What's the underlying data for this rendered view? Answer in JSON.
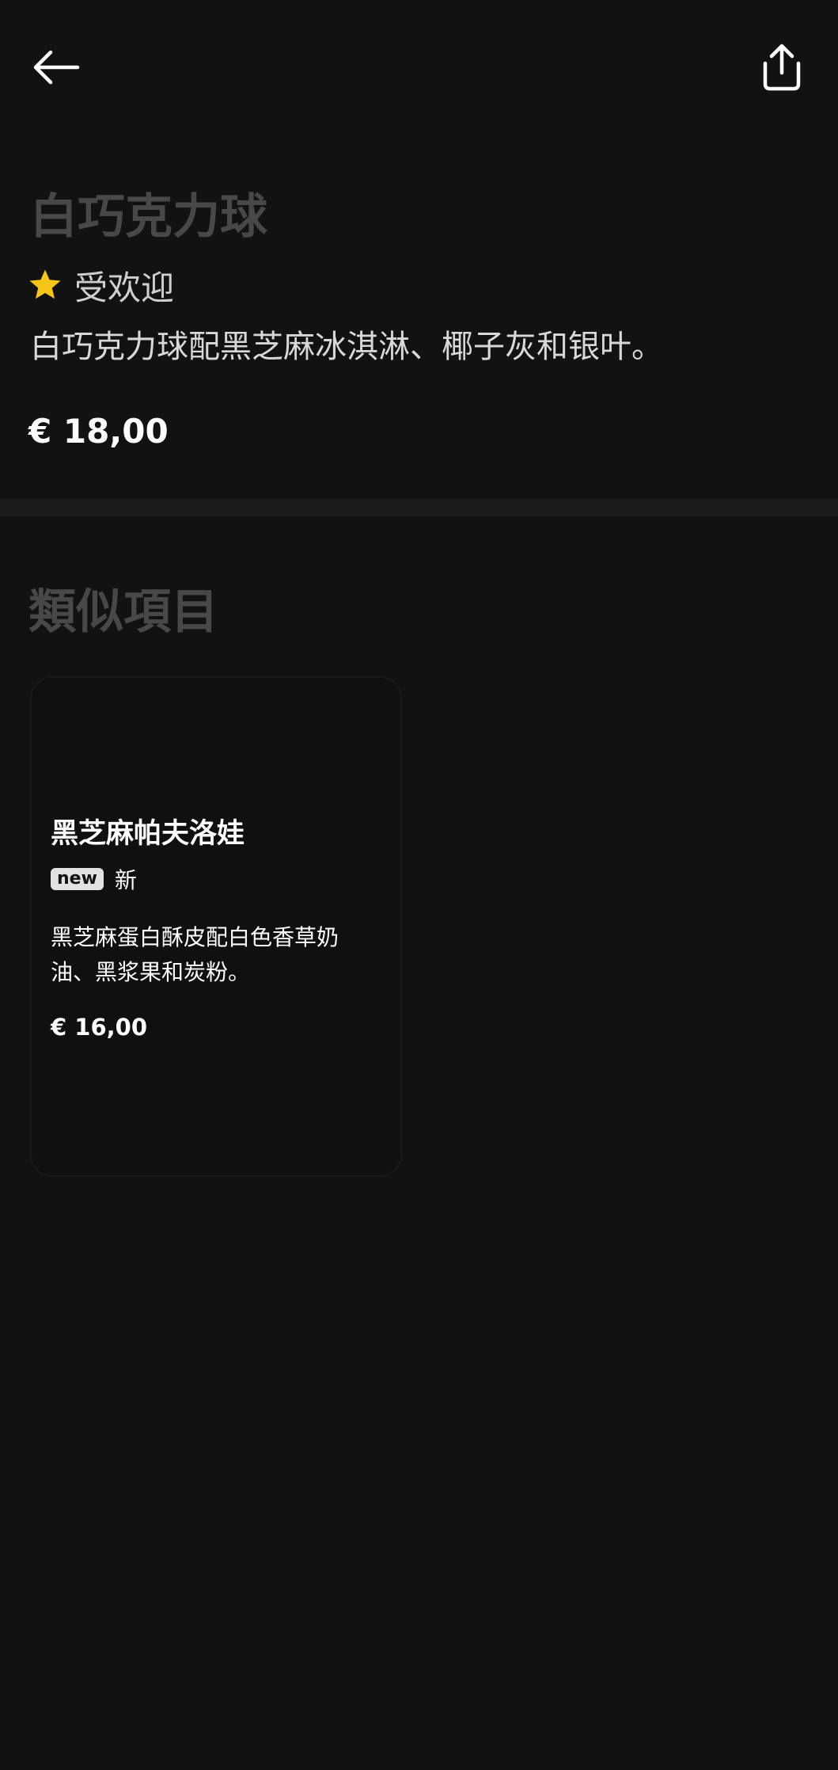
{
  "header": {
    "back_icon": "arrow-left-icon",
    "share_icon": "share-upload-icon"
  },
  "product": {
    "title": "白巧克力球",
    "popular_label": "受欢迎",
    "star_icon": "star-icon",
    "star_color": "#F5C518",
    "description": "白巧克力球配黑芝麻冰淇淋、椰子灰和银叶。",
    "price": "€ 18,00"
  },
  "similar": {
    "title": "類似項目",
    "items": [
      {
        "title": "黑芝麻帕夫洛娃",
        "badge": "new",
        "badge_text": "新",
        "description": "黑芝麻蛋白酥皮配白色香草奶油、黑浆果和炭粉。",
        "price": "€ 16,00"
      }
    ]
  },
  "colors": {
    "background": "#121212",
    "divider": "#1B1B1B",
    "heading_muted": "#484848",
    "badge_bg": "#E2E2E2"
  }
}
